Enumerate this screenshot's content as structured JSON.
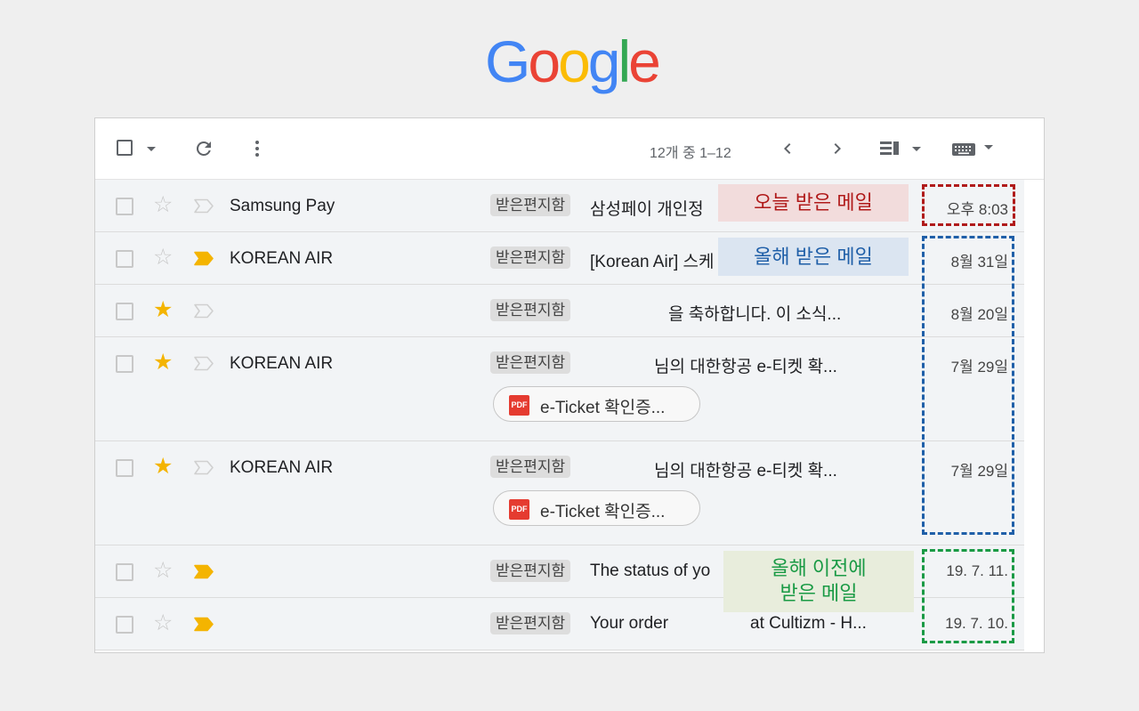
{
  "logo": {
    "letters": [
      "G",
      "o",
      "o",
      "g",
      "l",
      "e"
    ],
    "colors": [
      "#4285F4",
      "#EA4335",
      "#FBBC05",
      "#4285F4",
      "#34A853",
      "#EA4335"
    ]
  },
  "toolbar": {
    "count_text": "12개 중 1–12",
    "icons": [
      "select-all-checkbox",
      "dropdown-caret-icon",
      "refresh-icon",
      "more-vert-icon",
      "chevron-left-icon",
      "chevron-right-icon",
      "split-pane-icon",
      "keyboard-icon"
    ]
  },
  "emails": [
    {
      "sender": "Samsung Pay",
      "tag": "받은편지함",
      "subject": "삼성페이 개인정",
      "date": "오후 8:03",
      "starred": false,
      "important": false
    },
    {
      "sender": "KOREAN AIR",
      "tag": "받은편지함",
      "subject": "[Korean Air] 스케",
      "date": "8월 31일",
      "starred": false,
      "important": true
    },
    {
      "sender": "",
      "tag": "받은편지함",
      "subject": "을 축하합니다. 이 소식...",
      "date": "8월 20일",
      "starred": true,
      "important": false
    },
    {
      "sender": "KOREAN AIR",
      "tag": "받은편지함",
      "subject": "님의 대한항공 e-티켓 확...",
      "date": "7월 29일",
      "starred": true,
      "important": false,
      "attachment": "e-Ticket 확인증..."
    },
    {
      "sender": "KOREAN AIR",
      "tag": "받은편지함",
      "subject": "님의 대한항공 e-티켓 확...",
      "date": "7월 29일",
      "starred": true,
      "important": false,
      "attachment": "e-Ticket 확인증..."
    },
    {
      "sender": "",
      "tag": "받은편지함",
      "subject": "The status of yo",
      "date": "19. 7. 11.",
      "starred": false,
      "important": true
    },
    {
      "sender": "",
      "tag": "받은편지함",
      "subject": "Your order",
      "subject_tail": "at Cultizm - H...",
      "date": "19. 7. 10.",
      "starred": false,
      "important": true
    }
  ],
  "annotations": {
    "today": {
      "text": "오늘 받은 메일",
      "color": "#b01a1a",
      "bg": "#f2dcdc"
    },
    "this_year": {
      "text": "올해 받은 메일",
      "color": "#1f5fa8",
      "bg": "#dbe5f1"
    },
    "before": {
      "line1": "올해 이전에",
      "line2": "받은  메일",
      "color": "#1a9a45",
      "bg": "#e8eddc"
    }
  },
  "colors": {
    "star_on": "#f4b400",
    "star_off": "#c8c8c8",
    "important_on": "#f4b400",
    "important_off": "#d0d0d0"
  }
}
